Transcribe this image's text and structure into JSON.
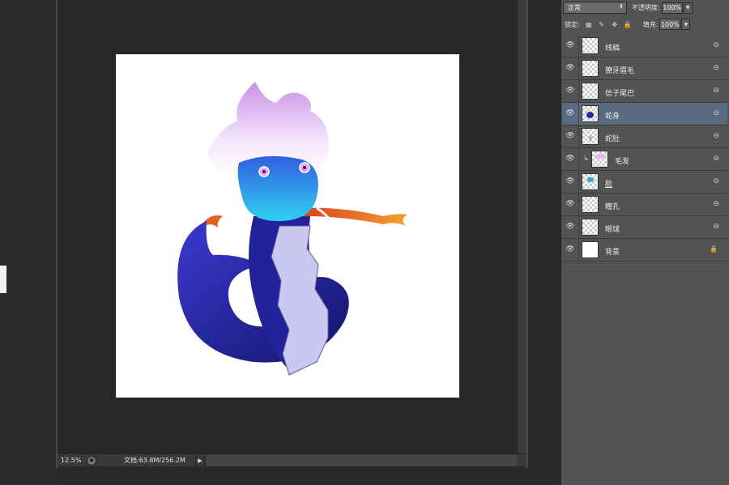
{
  "status": {
    "zoom": "12.5%",
    "doc_info": "文档:63.8M/256.2M",
    "arrow": "▶"
  },
  "panel": {
    "blend_mode": "正常",
    "opacity_label": "不透明度:",
    "opacity_value": "100%",
    "lock_label": "锁定:",
    "fill_label": "填充:",
    "fill_value": "100%"
  },
  "layers": [
    {
      "name": "线稿",
      "selected": false
    },
    {
      "name": "獠牙眉毛",
      "selected": false
    },
    {
      "name": "信子尾巴",
      "selected": false
    },
    {
      "name": "蛇身",
      "selected": true
    },
    {
      "name": "蛇肚",
      "selected": false
    },
    {
      "name": "毛发",
      "selected": false,
      "clipped": true
    },
    {
      "name": "脸",
      "selected": false
    },
    {
      "name": "瞳孔",
      "selected": false
    },
    {
      "name": "眼球",
      "selected": false
    },
    {
      "name": "背景",
      "selected": false,
      "locked": true
    }
  ],
  "colors": {
    "panel_bg": "#535353",
    "selected_layer": "#5a6a80",
    "workspace": "#282828",
    "snake_body": "#2a2aa0",
    "hair": "#e8b8f0",
    "face": "#30a0e0",
    "tongue": "#e86020"
  },
  "icons": {
    "visibility": "eye-icon",
    "link": "link-icon",
    "lock": "lock-icon"
  }
}
